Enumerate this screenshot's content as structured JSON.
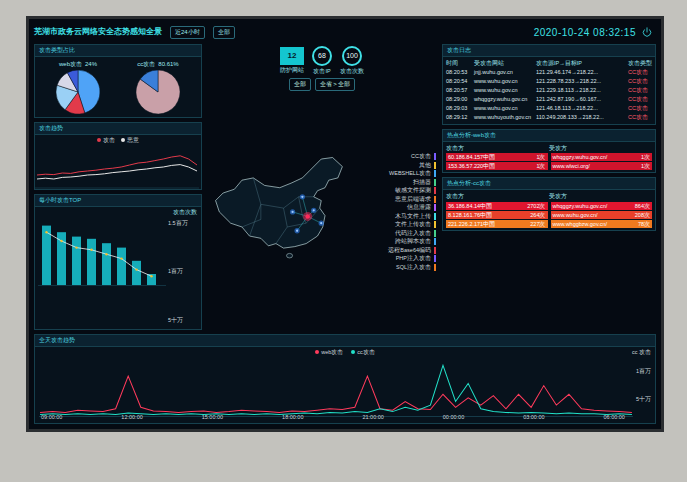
{
  "header": {
    "title": "芜湖市政务云网络安全态势感知全景",
    "filters": [
      "近24小时",
      "全部"
    ],
    "time": "2020-10-24 08:32:15"
  },
  "pies": {
    "title": "攻击类型占比",
    "charts": [
      {
        "label": "web攻击",
        "percent": "24%",
        "segments": [
          {
            "value": 45,
            "color": "#4fa3f7"
          },
          {
            "value": 15,
            "color": "#e23a4a"
          },
          {
            "value": 20,
            "color": "#9ad0f5"
          },
          {
            "value": 12,
            "color": "#d8d8e8"
          },
          {
            "value": 8,
            "color": "#3b5bd9"
          }
        ]
      },
      {
        "label": "cc攻击",
        "percent": "80.61%",
        "segments": [
          {
            "value": 85,
            "color": "#c9a0a8"
          },
          {
            "value": 15,
            "color": "#3a7fd9"
          }
        ]
      }
    ]
  },
  "trend": {
    "title": "攻击趋势",
    "legend": [
      {
        "label": "攻击",
        "color": "#e23a4a"
      },
      {
        "label": "恶意",
        "color": "#e6e6e6"
      }
    ],
    "series": [
      [
        0.3,
        0.32,
        0.31,
        0.35,
        0.34,
        0.38,
        0.4,
        0.42,
        0.45,
        0.47,
        0.5,
        0.55,
        0.6,
        0.62,
        0.66,
        0.7,
        0.75,
        0.78,
        0.7,
        0.55
      ],
      [
        0.2,
        0.22,
        0.2,
        0.24,
        0.25,
        0.27,
        0.3,
        0.31,
        0.33,
        0.36,
        0.38,
        0.4,
        0.43,
        0.45,
        0.48,
        0.5,
        0.54,
        0.56,
        0.5,
        0.4
      ]
    ]
  },
  "hourly": {
    "title": "每小时攻击TOP",
    "legend": "攻击次数",
    "ticks": [
      "1.5百万",
      "1百万",
      "5十万"
    ],
    "bars": [
      1.35,
      1.2,
      1.1,
      1.05,
      0.95,
      0.85,
      0.55,
      0.25
    ],
    "line": [
      1.2,
      1.0,
      0.85,
      0.8,
      0.7,
      0.6,
      0.35,
      0.2
    ]
  },
  "center": {
    "stats": [
      {
        "label": "防护网站",
        "value": "12",
        "kind": "box"
      },
      {
        "label": "攻击IP",
        "value": "68",
        "kind": "ring"
      },
      {
        "label": "攻击次数",
        "value": "100",
        "kind": "ring"
      }
    ],
    "breadcrumb": [
      "全部",
      "全省 > 全部"
    ],
    "attack_types": [
      {
        "label": "CC攻击",
        "color": "#7a5cff"
      },
      {
        "label": "其他",
        "color": "#f2c230"
      },
      {
        "label": "WEBSHELL攻击",
        "color": "#3fa9f5"
      },
      {
        "label": "扫描器",
        "color": "#45d18a"
      },
      {
        "label": "敏感文件探测",
        "color": "#e23a4a"
      },
      {
        "label": "恶意后端请求",
        "color": "#f07a1f"
      },
      {
        "label": "信息泄露",
        "color": "#b05cff"
      },
      {
        "label": "木马文件上传",
        "color": "#3fe0e6"
      },
      {
        "label": "文件上传攻击",
        "color": "#f2c230"
      },
      {
        "label": "代码注入攻击",
        "color": "#45d18a"
      },
      {
        "label": "跨站脚本攻击",
        "color": "#3fa9f5"
      },
      {
        "label": "远程Base64编码",
        "color": "#e23a4a"
      },
      {
        "label": "PHP注入攻击",
        "color": "#7a5cff"
      },
      {
        "label": "SQL注入攻击",
        "color": "#f07a1f"
      }
    ]
  },
  "log": {
    "title": "攻击日志",
    "columns": [
      "时间",
      "受攻击网站",
      "攻击源IP→目标IP",
      "攻击类型"
    ],
    "rows": [
      [
        "08:20:53",
        "jnjj.wuhu.gov.cn",
        "121.29.46.174→218.22...",
        "CC攻击"
      ],
      [
        "08:20:54",
        "www.wuhu.gov.cn",
        "121.228.78.233→218.22...",
        "CC攻击"
      ],
      [
        "08:20:57",
        "www.wuhu.gov.cn",
        "121.229.18.113→218.22...",
        "CC攻击"
      ],
      [
        "08:29:00",
        "whqggzy.wuhu.gov.cn",
        "121.242.87.190→60.167...",
        "CC攻击"
      ],
      [
        "08:29:03",
        "www.wuhu.gov.cn",
        "121.46.18.113→218.22...",
        "CC攻击"
      ],
      [
        "08:29:12",
        "www.wuhuyouth.gov.cn",
        "110.249.208.133→218.22...",
        "CC攻击"
      ]
    ]
  },
  "hotspots": [
    {
      "title": "热点分析-web攻击",
      "headers": [
        "攻击方",
        "受攻方"
      ],
      "rows": [
        {
          "source": "60.186.84.157中国",
          "source_count": "1次",
          "target": "whqggzy.wuhu.gov.cn/",
          "target_count": "1次",
          "color": "#d0142c"
        },
        {
          "source": "153.36.57.220中国",
          "source_count": "1次",
          "target": "www.wlwci.org/",
          "target_count": "1次",
          "color": "#d0142c"
        }
      ]
    },
    {
      "title": "热点分析-cc攻击",
      "headers": [
        "攻击方",
        "受攻方"
      ],
      "rows": [
        {
          "source": "36.186.84.14中国",
          "source_count": "2702次",
          "target": "whqggzy.wuhu.gov.cn/",
          "target_count": "864次",
          "color": "#e0162f"
        },
        {
          "source": "8.128.161.76中国",
          "source_count": "264次",
          "target": "www.wuhu.gov.cn/",
          "target_count": "208次",
          "color": "#e8402a"
        },
        {
          "source": "221.226.2.171中国",
          "source_count": "227次",
          "target": "www.whggbzw.gov.cn/",
          "target_count": "78次",
          "color": "#f07a1f"
        }
      ]
    }
  ],
  "daily": {
    "title": "全天攻击趋势",
    "unit": "cc 攻击",
    "legend": [
      {
        "label": "web攻击",
        "color": "#ff3b5c"
      },
      {
        "label": "cc攻击",
        "color": "#22e0c8"
      }
    ],
    "y_ticks": [
      "1百万",
      "5十万"
    ],
    "x_ticks": [
      "09:00:00",
      "12:00:00",
      "15:00:00",
      "18:00:00",
      "21:00:00",
      "00:00:00",
      "03:00:00",
      "06:00:00"
    ],
    "series": [
      [
        0.05,
        0.06,
        0.05,
        0.08,
        0.07,
        0.06,
        0.1,
        0.55,
        0.12,
        0.07,
        0.06,
        0.05,
        0.06,
        0.07,
        0.05,
        0.06,
        0.08,
        0.07,
        0.06,
        0.05,
        0.07,
        0.06,
        0.08,
        0.1,
        0.09,
        0.12,
        0.55,
        0.1,
        0.08,
        0.2,
        0.1,
        0.09,
        0.3,
        0.12,
        0.25,
        0.15,
        0.28,
        0.1,
        0.3,
        0.12,
        0.42,
        0.15,
        0.3,
        0.1,
        0.08,
        0.07,
        0.06,
        0.05
      ],
      [
        0.02,
        0.03,
        0.02,
        0.03,
        0.02,
        0.03,
        0.02,
        0.04,
        0.03,
        0.02,
        0.03,
        0.02,
        0.03,
        0.02,
        0.03,
        0.02,
        0.03,
        0.02,
        0.03,
        0.02,
        0.03,
        0.04,
        0.03,
        0.05,
        0.04,
        0.06,
        0.05,
        0.1,
        0.06,
        0.12,
        0.08,
        0.15,
        0.7,
        0.2,
        0.45,
        0.1,
        0.06,
        0.05,
        0.04,
        0.05,
        0.04,
        0.03,
        0.04,
        0.03,
        0.03,
        0.02,
        0.03,
        0.02
      ]
    ]
  }
}
